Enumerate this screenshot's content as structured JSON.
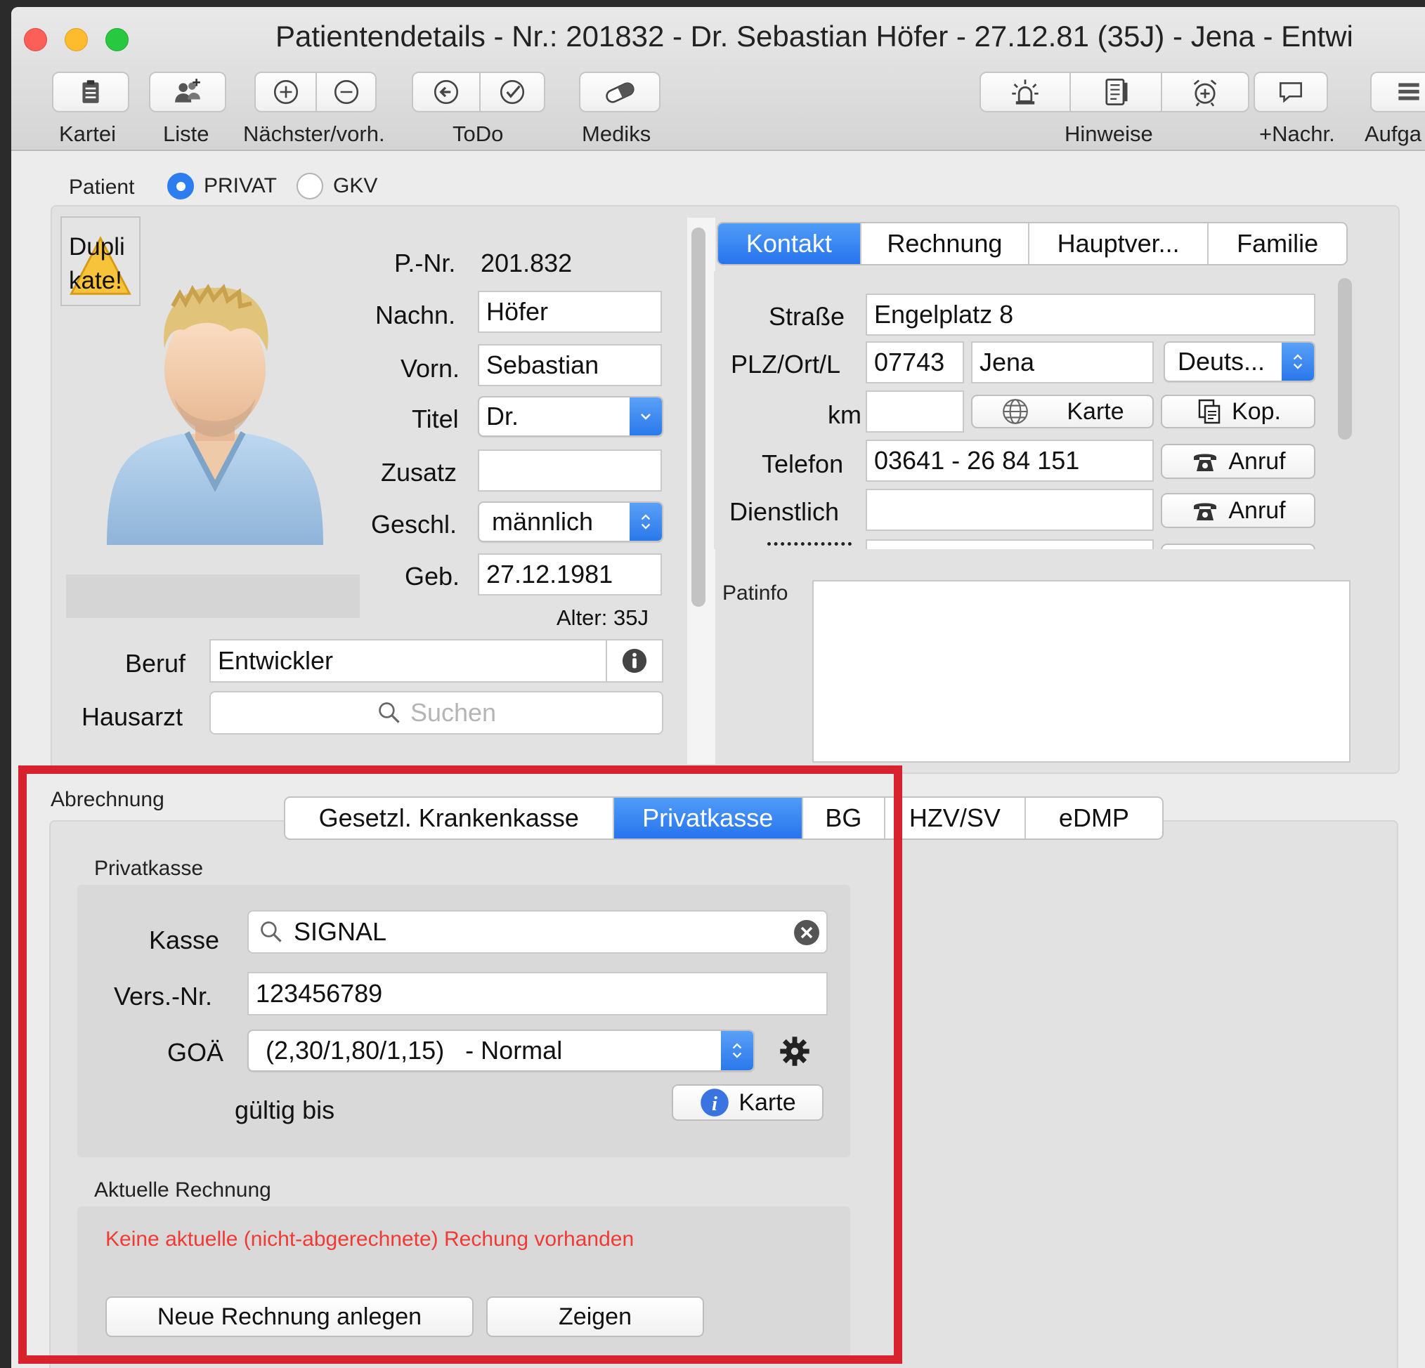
{
  "window": {
    "title": "Patientendetails - Nr.: 201832 - Dr. Sebastian Höfer - 27.12.81 (35J) - Jena - Entwi"
  },
  "toolbar": {
    "kartei": "Kartei",
    "liste": "Liste",
    "naechster": "Nächster/vorh.",
    "todo": "ToDo",
    "mediks": "Mediks",
    "hinweise": "Hinweise",
    "nachr": "+Nachr.",
    "aufga": "Aufga"
  },
  "patient": {
    "label": "Patient",
    "type_privat": "PRIVAT",
    "type_gkv": "GKV",
    "duplikate": "Dupli kate!",
    "pnr_label": "P.-Nr.",
    "pnr_value": "201.832",
    "nachname_label": "Nachn.",
    "nachname_value": "Höfer",
    "vorname_label": "Vorn.",
    "vorname_value": "Sebastian",
    "titel_label": "Titel",
    "titel_value": "Dr.",
    "zusatz_label": "Zusatz",
    "zusatz_value": "",
    "geschl_label": "Geschl.",
    "geschl_value": "männlich",
    "geb_label": "Geb.",
    "geb_value": "27.12.1981",
    "alter": "Alter: 35J",
    "beruf_label": "Beruf",
    "beruf_value": "Entwickler",
    "hausarzt_label": "Hausarzt",
    "hausarzt_placeholder": "Suchen"
  },
  "contact_tabs": [
    "Kontakt",
    "Rechnung",
    "Hauptver...",
    "Familie"
  ],
  "contact": {
    "strasse_label": "Straße",
    "strasse_value": "Engelplatz 8",
    "plz_label": "PLZ/Ort/L",
    "plz_value": "07743",
    "ort_value": "Jena",
    "land_value": "Deuts...",
    "km_label": "km",
    "km_value": "",
    "karte_btn": "Karte",
    "kop_btn": "Kop.",
    "telefon_label": "Telefon",
    "telefon_value": "03641 - 26 84 151",
    "anruf_btn": "Anruf",
    "dienstlich_label": "Dienstlich",
    "dienstlich_value": "",
    "patinfo_label": "Patinfo"
  },
  "billing": {
    "label": "Abrechnung",
    "tabs": [
      "Gesetzl. Krankenkasse",
      "Privatkasse",
      "BG",
      "HZV/SV",
      "eDMP"
    ],
    "section_title": "Privatkasse",
    "kasse_label": "Kasse",
    "kasse_value": "SIGNAL",
    "versnr_label": "Vers.-Nr.",
    "versnr_value": "123456789",
    "goae_label": "GOÄ",
    "goae_value": "(2,30/1,80/1,15)   - Normal",
    "gueltig_label": "gültig bis",
    "karte_btn": "Karte",
    "current_title": "Aktuelle Rechnung",
    "no_invoice_msg": "Keine aktuelle (nicht-abgerechnete) Rechung vorhanden",
    "new_invoice_btn": "Neue Rechnung anlegen",
    "show_btn": "Zeigen"
  },
  "colors": {
    "accent": "#2b7df0",
    "highlight_frame": "#d8232e",
    "error_text": "#f03a33"
  }
}
